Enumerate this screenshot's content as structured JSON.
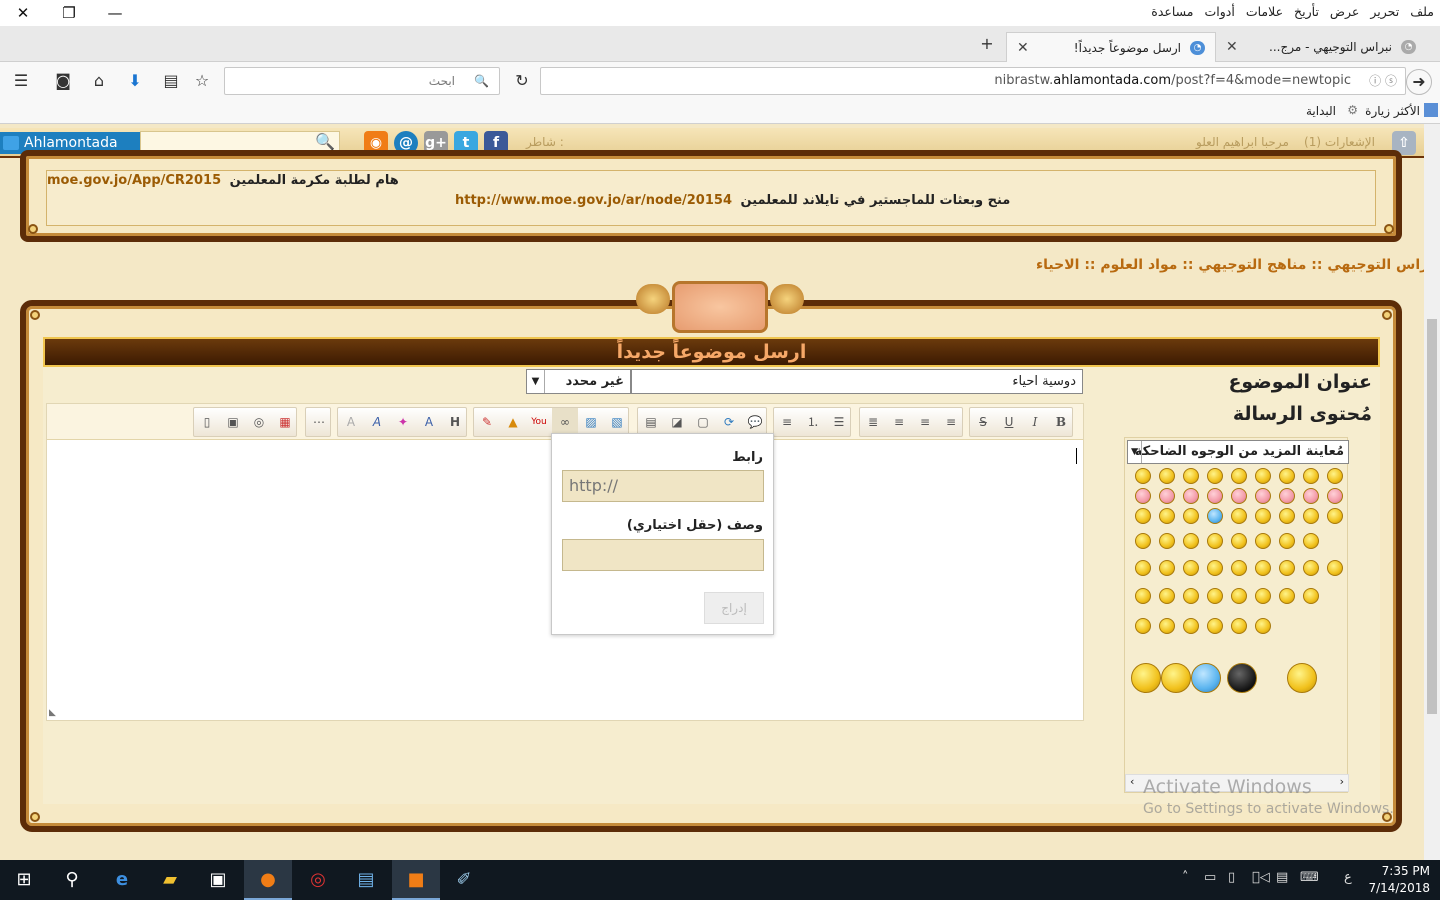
{
  "window": {
    "close": "✕",
    "restore": "❐",
    "minimize": "—"
  },
  "menu": [
    "ملف",
    "تحرير",
    "عرض",
    "تأريخ",
    "علامات",
    "أدوات",
    "مساعدة"
  ],
  "tabs": [
    {
      "title": "نبراس التوجيهي - مرج...",
      "active": false
    },
    {
      "title": "ارسل موضوعاً جديداً!",
      "active": true
    }
  ],
  "nav": {
    "search_placeholder": "ابحث",
    "url_prefix": "nibrastw.",
    "url_domain": "ahlamontada.com",
    "url_path": "/post?f=4&mode=newtopic"
  },
  "bookmarks": {
    "most_visited": "الأكثر زيارة",
    "home": "البداية"
  },
  "forum_toolbar": {
    "brand": "Ahlamontada",
    "share_label": "شاطر :",
    "notifications": "الإشعارات (1)",
    "user": "مرحبا ابراهيم العلو"
  },
  "news": {
    "line1_link": "moe.gov.jo/App/CR2015",
    "line1_text": "هام لطلبة مكرمة المعلمين",
    "line2_link": "http://www.moe.gov.jo/ar/node/20154",
    "line2_text": "منح وبعثات للماجستير في تايلاند للمعلمين"
  },
  "breadcrumb": "نبراس التوجيهي  :: مناهج التوجيهي :: مواد العلوم :: الاحياء",
  "post_form": {
    "header": "ارسل موضوعاً جديداً",
    "subject_label": "عنوان الموضوع",
    "subject_value": "دوسية احياء",
    "prefix_value": "غير محدد",
    "message_label": "مُحتوى الرسالة"
  },
  "link_popup": {
    "url_label": "رابط",
    "url_value": "http://",
    "desc_label": "وصف (حقل اختياري)",
    "insert_button": "إدراج"
  },
  "smilies": {
    "select_value": "مُعاينة المزيد من الوجوه الضاحكة"
  },
  "watermark": {
    "line1": "Activate Windows",
    "line2": "Go to Settings to activate Windows."
  },
  "taskbar": {
    "time": "7:35 PM",
    "date": "7/14/2018",
    "lang": "ع"
  }
}
